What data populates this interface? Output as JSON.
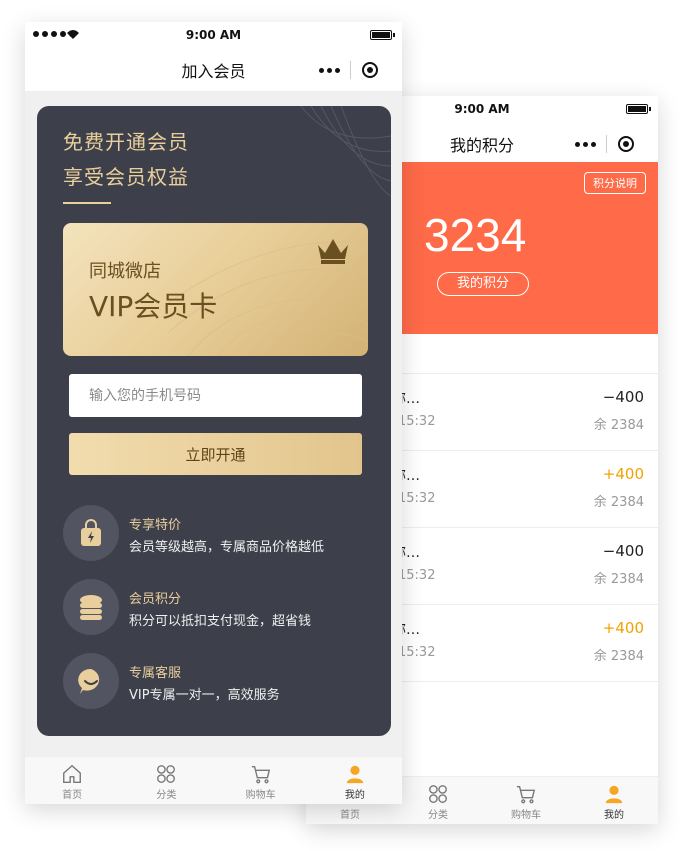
{
  "back_screen": {
    "status_time": "9:00 AM",
    "title": "我的积分",
    "explain_button": "积分说明",
    "points_value": "3234",
    "points_label": "我的积分",
    "records": [
      {
        "name": "品名称…",
        "time": "15:32",
        "amount": "−400",
        "balance": "余 2384",
        "plus": false
      },
      {
        "name": "品名称…",
        "time": "15:32",
        "amount": "+400",
        "balance": "余 2384",
        "plus": true
      },
      {
        "name": "品名称…",
        "time": "15:32",
        "amount": "−400",
        "balance": "余 2384",
        "plus": false
      },
      {
        "name": "品名称…",
        "time": "15:32",
        "amount": "+400",
        "balance": "余 2384",
        "plus": true
      }
    ],
    "tabs": [
      "首页",
      "分类",
      "购物车",
      "我的"
    ]
  },
  "front_screen": {
    "status_time": "9:00 AM",
    "title": "加入会员",
    "hero_line1": "免费开通会员",
    "hero_line2": "享受会员权益",
    "card_shop": "同城微店",
    "card_vip": "VIP会员卡",
    "phone_placeholder": "输入您的手机号码",
    "open_button": "立即开通",
    "benefits": [
      {
        "title": "专享特价",
        "desc": "会员等级越高，专属商品价格越低",
        "icon": "shopping-bag-icon"
      },
      {
        "title": "会员积分",
        "desc": "积分可以抵扣支付现金，超省钱",
        "icon": "coin-stack-icon"
      },
      {
        "title": "专属客服",
        "desc": "VIP专属一对一，高效服务",
        "icon": "chat-bubble-icon"
      }
    ],
    "tabs": [
      "首页",
      "分类",
      "购物车",
      "我的"
    ]
  },
  "colors": {
    "accent_orange": "#ff6a48",
    "gold": "#e8cf9c",
    "dark_card": "#3d3f4b",
    "plus_amount": "#f2a200",
    "active_tab": "#f5a623"
  }
}
